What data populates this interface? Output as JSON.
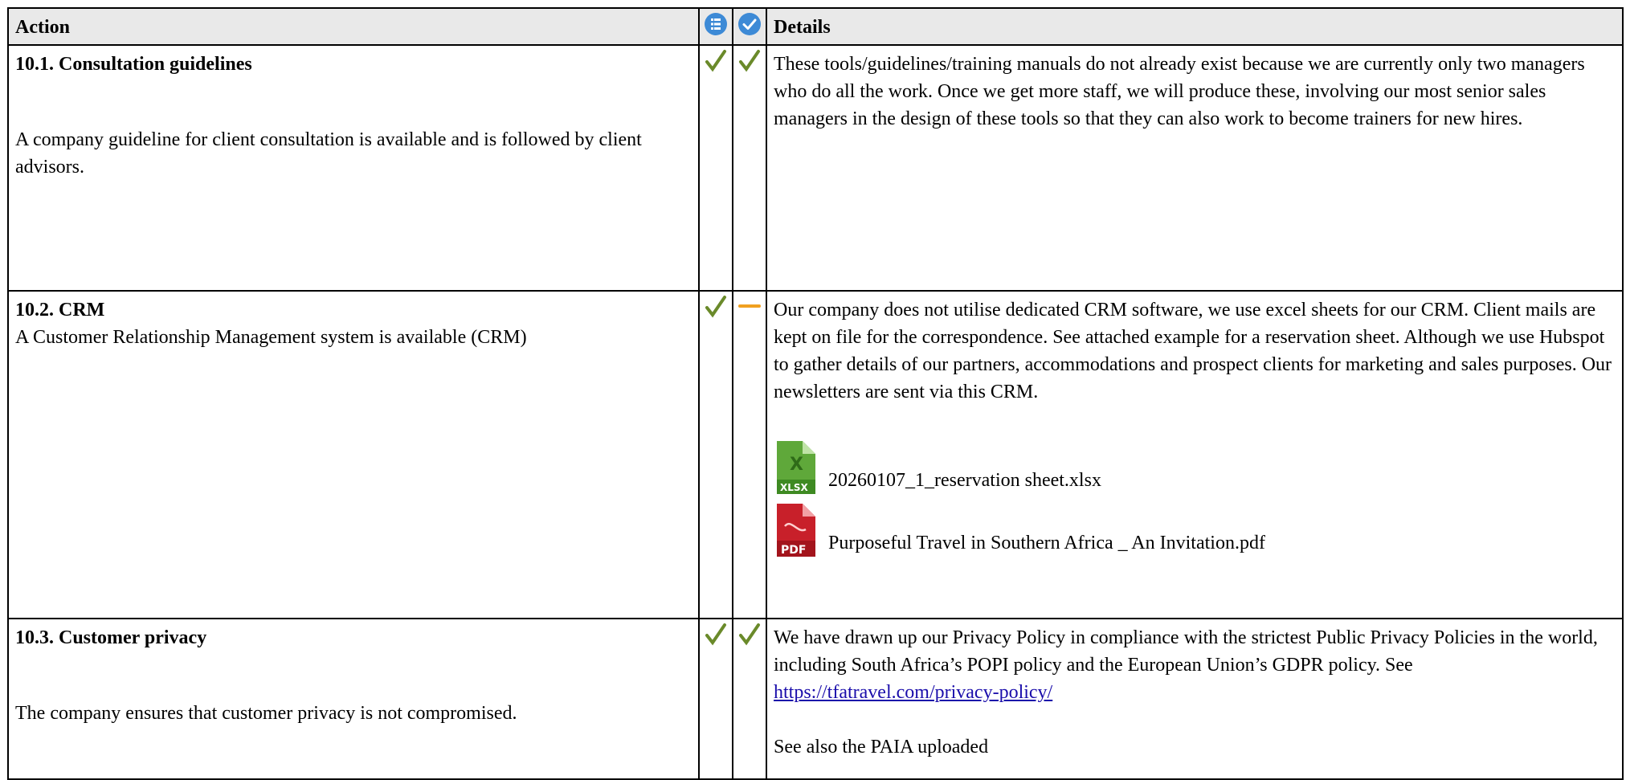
{
  "header": {
    "action": "Action",
    "details": "Details",
    "col1_icon": "list-icon",
    "col2_icon": "check-circle-icon"
  },
  "rows": [
    {
      "title": "10.1. Consultation guidelines",
      "desc": "A company guideline for client consultation is available and is followed by client advisors.",
      "mark1": "check",
      "mark2": "check",
      "details": "These tools/guidelines/training manuals do not already exist because we are currently only two managers who do all the work. Once we get more staff, we will produce these, involving our most senior sales managers in the design of these tools so that they can also work to become trainers for new hires."
    },
    {
      "title": "10.2. CRM",
      "desc": "A Customer Relationship Management system is available (CRM)",
      "mark1": "check",
      "mark2": "partial",
      "details": "Our company does not utilise dedicated CRM software, we use excel sheets for our CRM. Client mails are kept on file for the correspondence. See attached example for a reservation sheet. Although we use Hubspot to gather details of our partners, accommodations and prospect clients for marketing and sales purposes. Our newsletters are sent via this CRM.",
      "attachments": [
        {
          "icon": "xlsx-file-icon",
          "name": "20260107_1_reservation sheet.xlsx"
        },
        {
          "icon": "pdf-file-icon",
          "name": "Purposeful Travel in Southern Africa _ An Invitation.pdf"
        }
      ]
    },
    {
      "title": "10.3. Customer privacy",
      "desc": "The company ensures that customer privacy is not compromised.",
      "mark1": "check",
      "mark2": "check",
      "details_before_link": "We have drawn up our Privacy Policy in compliance with the strictest Public Privacy Policies in the world, including South Africa’s POPI policy and the European Union’s GDPR policy. See ",
      "link": "https://tfatravel.com/privacy-policy/",
      "details_after": "See also the PAIA uploaded"
    }
  ],
  "colors": {
    "check": "#6a8a2a",
    "partial": "#f0a020",
    "header_bg": "#e9e9e9",
    "icon_blue": "#3d8ad6",
    "xlsx_green": "#5fa83a",
    "pdf_red": "#c8202a"
  }
}
